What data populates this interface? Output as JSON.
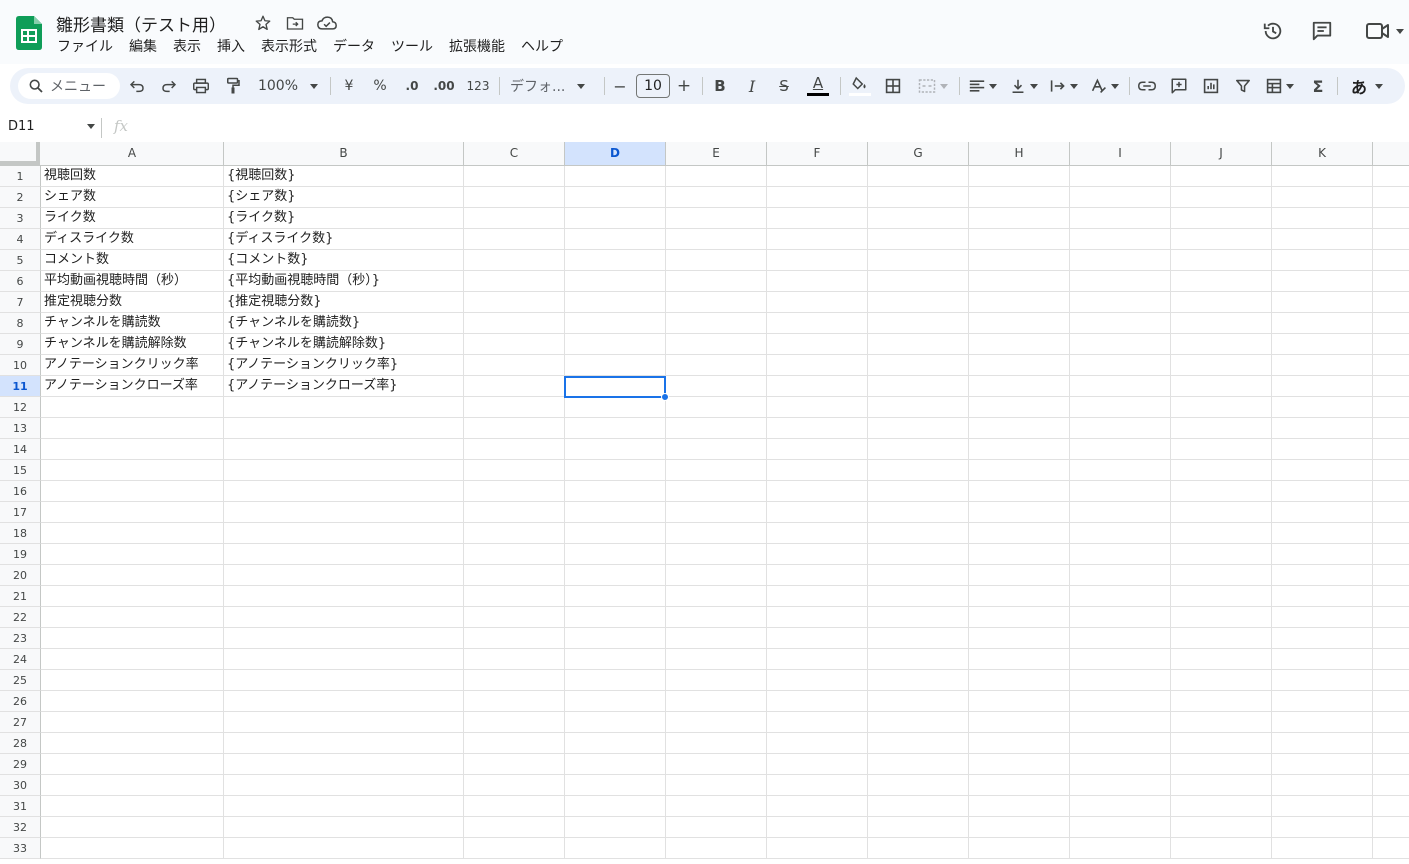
{
  "document": {
    "title": "雛形書類（テスト用）"
  },
  "menu": [
    "ファイル",
    "編集",
    "表示",
    "挿入",
    "表示形式",
    "データ",
    "ツール",
    "拡張機能",
    "ヘルプ"
  ],
  "toolbar": {
    "search_placeholder": "メニュー",
    "zoom": "100%",
    "currency": "¥",
    "percent": "%",
    "decrease_decimal": ".0",
    "increase_decimal": ".00",
    "number_format": "123",
    "font": "デフォ...",
    "font_size": "10",
    "minus": "−",
    "plus": "+",
    "bold": "B",
    "italic": "I",
    "strike": "S",
    "text_color_glyph": "A",
    "input_mode": "あ",
    "sum": "Σ"
  },
  "formula_bar": {
    "cell_ref": "D11",
    "fx": "fx",
    "value": ""
  },
  "columns": [
    "A",
    "B",
    "C",
    "D",
    "E",
    "F",
    "G",
    "H",
    "I",
    "J",
    "K"
  ],
  "selected_column": "D",
  "selected_row": 11,
  "rows": [
    {
      "num": "1",
      "a": "視聴回数",
      "b": "{視聴回数}"
    },
    {
      "num": "2",
      "a": "シェア数",
      "b": "{シェア数}"
    },
    {
      "num": "3",
      "a": "ライク数",
      "b": "{ライク数}"
    },
    {
      "num": "4",
      "a": "ディスライク数",
      "b": "{ディスライク数}"
    },
    {
      "num": "5",
      "a": "コメント数",
      "b": "{コメント数}"
    },
    {
      "num": "6",
      "a": "平均動画視聴時間（秒）",
      "b": "{平均動画視聴時間（秒）}"
    },
    {
      "num": "7",
      "a": "推定視聴分数",
      "b": "{推定視聴分数}"
    },
    {
      "num": "8",
      "a": "チャンネルを購読数",
      "b": "{チャンネルを購読数}"
    },
    {
      "num": "9",
      "a": "チャンネルを購読解除数",
      "b": "{チャンネルを購読解除数}"
    },
    {
      "num": "10",
      "a": "アノテーションクリック率",
      "b": "{アノテーションクリック率}"
    },
    {
      "num": "11",
      "a": "アノテーションクローズ率",
      "b": "{アノテーションクローズ率}"
    },
    {
      "num": "12",
      "a": "",
      "b": ""
    },
    {
      "num": "13",
      "a": "",
      "b": ""
    },
    {
      "num": "14",
      "a": "",
      "b": ""
    },
    {
      "num": "15",
      "a": "",
      "b": ""
    },
    {
      "num": "16",
      "a": "",
      "b": ""
    },
    {
      "num": "17",
      "a": "",
      "b": ""
    },
    {
      "num": "18",
      "a": "",
      "b": ""
    },
    {
      "num": "19",
      "a": "",
      "b": ""
    },
    {
      "num": "20",
      "a": "",
      "b": ""
    },
    {
      "num": "21",
      "a": "",
      "b": ""
    },
    {
      "num": "22",
      "a": "",
      "b": ""
    },
    {
      "num": "23",
      "a": "",
      "b": ""
    },
    {
      "num": "24",
      "a": "",
      "b": ""
    },
    {
      "num": "25",
      "a": "",
      "b": ""
    },
    {
      "num": "26",
      "a": "",
      "b": ""
    },
    {
      "num": "27",
      "a": "",
      "b": ""
    },
    {
      "num": "28",
      "a": "",
      "b": ""
    },
    {
      "num": "29",
      "a": "",
      "b": ""
    },
    {
      "num": "30",
      "a": "",
      "b": ""
    },
    {
      "num": "31",
      "a": "",
      "b": ""
    },
    {
      "num": "32",
      "a": "",
      "b": ""
    },
    {
      "num": "33",
      "a": "",
      "b": ""
    }
  ],
  "colors": {
    "accent": "#0b57d0",
    "selection": "#1a73e8",
    "sheets_green": "#0f9d58",
    "toolbar_bg": "#edf2fa"
  }
}
